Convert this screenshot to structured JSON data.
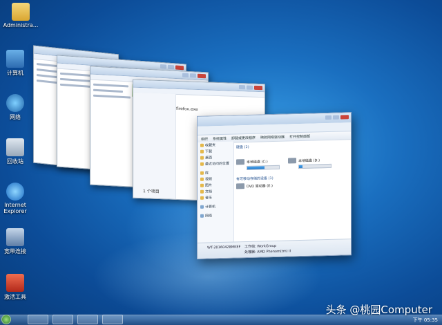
{
  "desktop": {
    "icons": [
      {
        "label": "Administra...",
        "icon": "folder-user-icon"
      },
      {
        "label": "计算机",
        "icon": "computer-icon"
      },
      {
        "label": "网络",
        "icon": "network-icon"
      },
      {
        "label": "回收站",
        "icon": "recycle-bin-icon"
      },
      {
        "label": "Internet Explorer",
        "icon": "ie-icon"
      },
      {
        "label": "宽带连接",
        "icon": "broadband-icon"
      },
      {
        "label": "激活工具",
        "icon": "tool-icon"
      }
    ]
  },
  "front_window": {
    "toolbar": [
      "组织",
      "系统属性",
      "卸载或更改程序",
      "映射网络驱动器",
      "打开控制面板"
    ],
    "nav": [
      "收藏夹",
      "下载",
      "桌面",
      "最近访问的位置",
      "库",
      "视频",
      "图片",
      "文档",
      "音乐",
      "计算机",
      "网络"
    ],
    "section_hdd": "硬盘 (2)",
    "drives": [
      {
        "label": "本地磁盘 (C:)",
        "fill": 0.55
      },
      {
        "label": "本地磁盘 (D:)",
        "fill": 0.1
      }
    ],
    "section_removable": "有可移动存储的设备 (1)",
    "dvd": "DVD 驱动器 (E:)",
    "details_name": "WT-20160428MKEF",
    "details_workgroup": "工作组: WorkGroup",
    "details_processor": "处理器: AMD Phenom(tm) II"
  },
  "back_windows": {
    "file_item": "firefox.exe",
    "status": "1 个项目"
  },
  "taskbar": {
    "clock": "下午 05:35"
  },
  "watermark": "头条 @桃园Computer"
}
